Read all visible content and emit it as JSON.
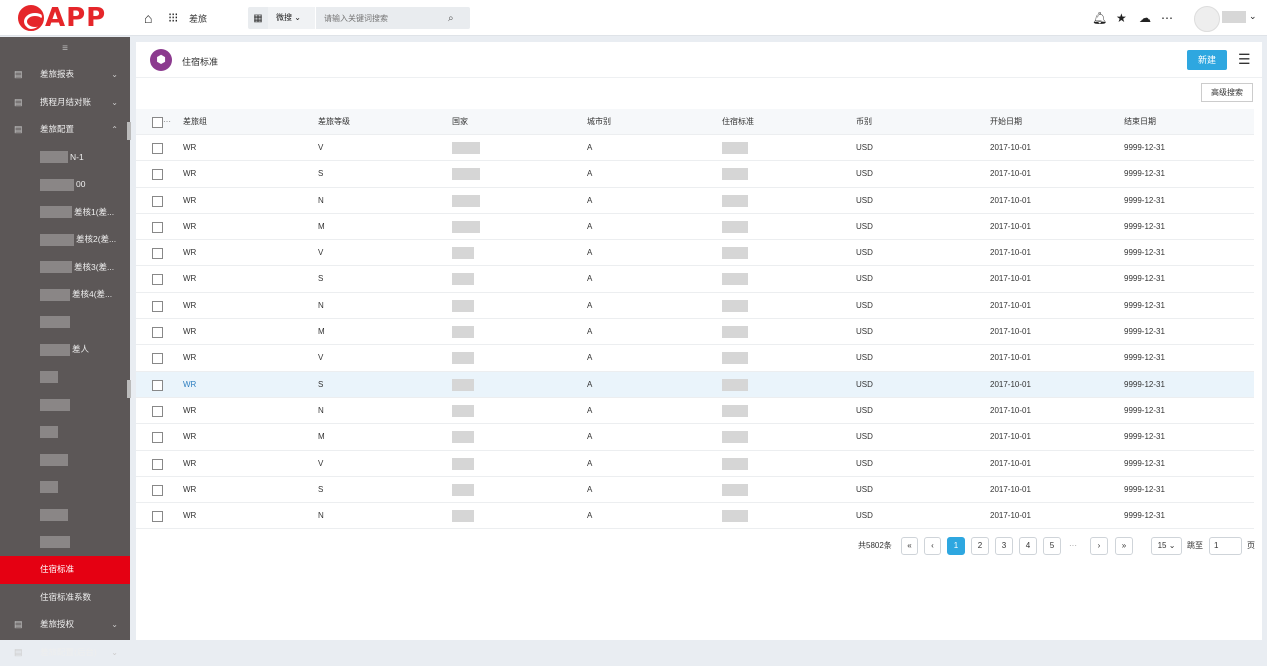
{
  "app": {
    "logo_text": "APP",
    "module": "差旅"
  },
  "search": {
    "category": "微搜",
    "placeholder": "请输入关键词搜索"
  },
  "sidebar": {
    "collapse_glyph": "≡",
    "items": [
      {
        "label": "差旅报表",
        "icon": "doc-icon",
        "chevron": "⌄"
      },
      {
        "label": "携程月结对账",
        "icon": "doc-icon",
        "chevron": "⌄"
      },
      {
        "label": "差旅配置",
        "icon": "doc-icon",
        "chevron": "⌃"
      }
    ],
    "sub_items": [
      "N-1",
      "00",
      "差核1(差...",
      "差核2(差...",
      "差核3(差...",
      "差核4(差...",
      "",
      "差人",
      "",
      "",
      "",
      "",
      "",
      "",
      ""
    ],
    "active": "住宿标准",
    "after": [
      "住宿标准系数"
    ],
    "bottom": [
      {
        "label": "差旅授权",
        "chevron": "⌄"
      },
      {
        "label": "差旅配置(后台)",
        "chevron": "⌄"
      }
    ]
  },
  "page": {
    "title": "住宿标准",
    "new_label": "新建",
    "advanced_search": "高级搜索"
  },
  "table": {
    "headers": [
      "差旅组",
      "差旅等级",
      "国家",
      "城市别",
      "住宿标准",
      "币别",
      "开始日期",
      "结束日期"
    ],
    "rows": [
      {
        "group": "WR",
        "level": "V",
        "city": "A",
        "currency": "USD",
        "start": "2017-10-01",
        "end": "9999-12-31"
      },
      {
        "group": "WR",
        "level": "S",
        "city": "A",
        "currency": "USD",
        "start": "2017-10-01",
        "end": "9999-12-31"
      },
      {
        "group": "WR",
        "level": "N",
        "city": "A",
        "currency": "USD",
        "start": "2017-10-01",
        "end": "9999-12-31"
      },
      {
        "group": "WR",
        "level": "M",
        "city": "A",
        "currency": "USD",
        "start": "2017-10-01",
        "end": "9999-12-31"
      },
      {
        "group": "WR",
        "level": "V",
        "city": "A",
        "currency": "USD",
        "start": "2017-10-01",
        "end": "9999-12-31"
      },
      {
        "group": "WR",
        "level": "S",
        "city": "A",
        "currency": "USD",
        "start": "2017-10-01",
        "end": "9999-12-31"
      },
      {
        "group": "WR",
        "level": "N",
        "city": "A",
        "currency": "USD",
        "start": "2017-10-01",
        "end": "9999-12-31"
      },
      {
        "group": "WR",
        "level": "M",
        "city": "A",
        "currency": "USD",
        "start": "2017-10-01",
        "end": "9999-12-31"
      },
      {
        "group": "WR",
        "level": "V",
        "city": "A",
        "currency": "USD",
        "start": "2017-10-01",
        "end": "9999-12-31"
      },
      {
        "group": "WR",
        "level": "S",
        "city": "A",
        "currency": "USD",
        "start": "2017-10-01",
        "end": "9999-12-31"
      },
      {
        "group": "WR",
        "level": "N",
        "city": "A",
        "currency": "USD",
        "start": "2017-10-01",
        "end": "9999-12-31"
      },
      {
        "group": "WR",
        "level": "M",
        "city": "A",
        "currency": "USD",
        "start": "2017-10-01",
        "end": "9999-12-31"
      },
      {
        "group": "WR",
        "level": "V",
        "city": "A",
        "currency": "USD",
        "start": "2017-10-01",
        "end": "9999-12-31"
      },
      {
        "group": "WR",
        "level": "S",
        "city": "A",
        "currency": "USD",
        "start": "2017-10-01",
        "end": "9999-12-31"
      },
      {
        "group": "WR",
        "level": "N",
        "city": "A",
        "currency": "USD",
        "start": "2017-10-01",
        "end": "9999-12-31"
      }
    ],
    "selected_row": 9
  },
  "pager": {
    "total": "共5802条",
    "prev_first": "«",
    "prev": "‹",
    "pages": [
      "1",
      "2",
      "3",
      "4",
      "5"
    ],
    "ellipsis": "···",
    "next": "›",
    "next_last": "»",
    "page_size": "15 ⌄",
    "goto_label": "跳至",
    "goto_value": "1",
    "page_unit": "页"
  },
  "colors": {
    "brand": "#e5262a",
    "accent": "#2ea7e0",
    "active_menu": "#e50012",
    "sidebar": "#5c5757"
  }
}
